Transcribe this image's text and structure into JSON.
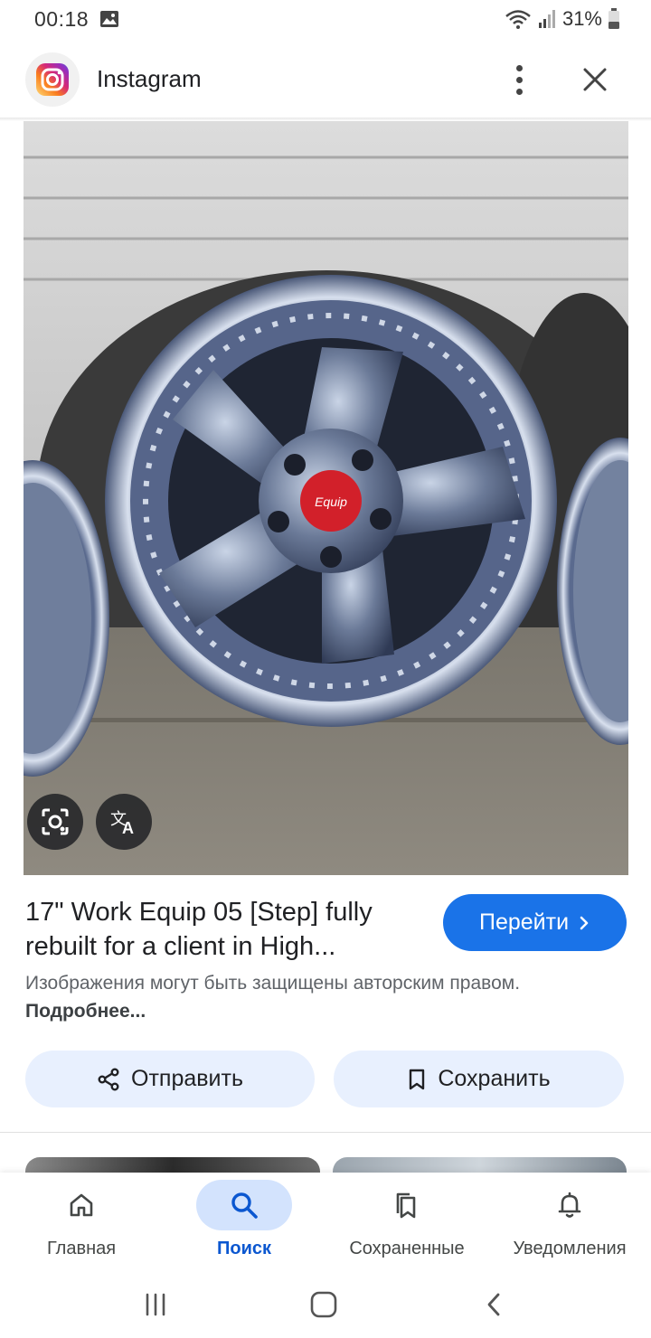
{
  "status_bar": {
    "time": "00:18",
    "battery": "31%"
  },
  "header": {
    "app_name": "Instagram"
  },
  "result": {
    "title": "17\" Work Equip 05 [Step] fully rebuilt for a client in High...",
    "visit_label": "Перейти",
    "copyright_text": "Изображения могут быть защищены авторским правом.",
    "more_link": "Подробнее..."
  },
  "actions": {
    "share_label": "Отправить",
    "save_label": "Сохранить"
  },
  "bottom_nav": {
    "items": [
      {
        "label": "Главная",
        "icon": "home-icon"
      },
      {
        "label": "Поиск",
        "icon": "search-icon",
        "active": true
      },
      {
        "label": "Сохраненные",
        "icon": "saved-collections-icon"
      },
      {
        "label": "Уведомления",
        "icon": "bell-icon"
      }
    ]
  },
  "colors": {
    "accent_blue": "#1a73e8",
    "active_nav_text": "#0b57d0",
    "active_nav_pill": "#d3e3fd",
    "action_button_bg": "#e8f0fe"
  }
}
